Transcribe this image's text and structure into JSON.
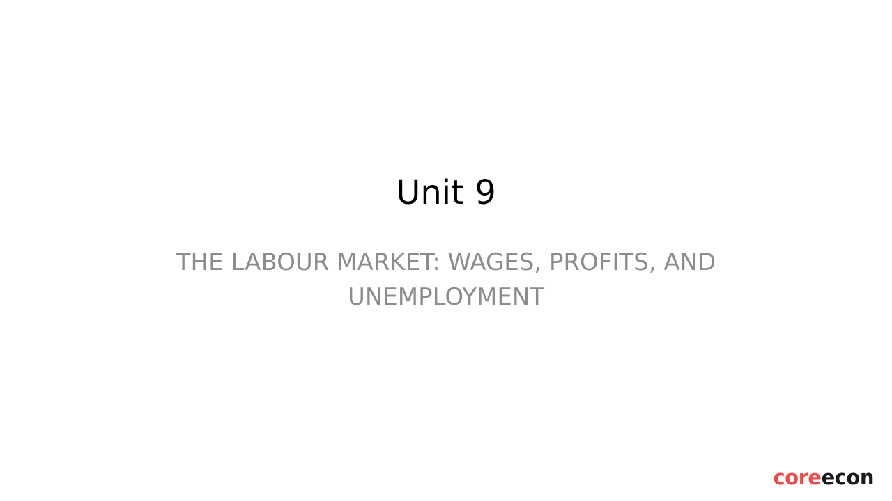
{
  "slide": {
    "title": "Unit 9",
    "subtitle": "THE LABOUR MARKET: WAGES, PROFITS, AND UNEMPLOYMENT"
  },
  "logo": {
    "part1": "core",
    "part2": "econ",
    "colors": {
      "part1": "#ef4a4a",
      "part2": "#1a1a1a"
    }
  },
  "colors": {
    "background": "#ffffff",
    "title": "#000000",
    "subtitle": "#8c8c8c"
  }
}
